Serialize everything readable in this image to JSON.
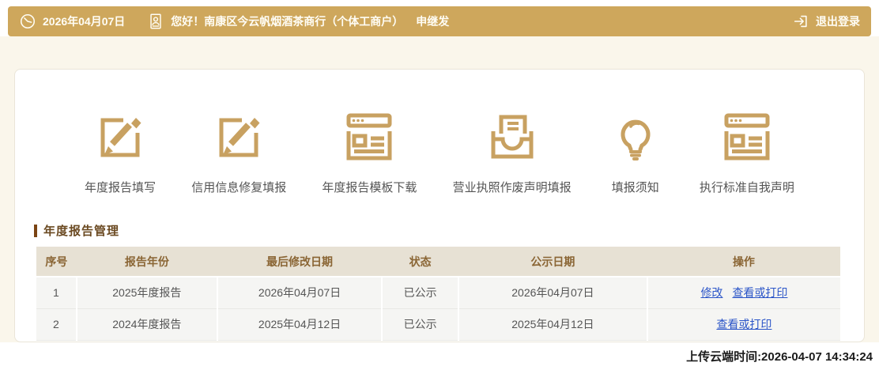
{
  "topbar": {
    "date": "2026年04月07日",
    "greeting": "您好！南康区今云帆烟酒茶商行（个体工商户）",
    "operator": "申继发",
    "logout_label": "退出登录"
  },
  "shortcuts": [
    {
      "icon": "pencil-square-icon",
      "label": "年度报告填写"
    },
    {
      "icon": "pencil-square-icon",
      "label": "信用信息修复填报"
    },
    {
      "icon": "webpage-template-icon",
      "label": "年度报告模板下载"
    },
    {
      "icon": "inbox-document-icon",
      "label": "营业执照作废声明填报"
    },
    {
      "icon": "lightbulb-icon",
      "label": "填报须知"
    },
    {
      "icon": "webpage-declaration-icon",
      "label": "执行标准自我声明"
    }
  ],
  "report_section": {
    "title": "年度报告管理",
    "table": {
      "headers": [
        "序号",
        "报告年份",
        "最后修改日期",
        "状态",
        "公示日期",
        "操作"
      ],
      "rows": [
        {
          "index": "1",
          "year": "2025年度报告",
          "modified": "2026年04月07日",
          "status": "已公示",
          "published": "2026年04月07日",
          "actions": [
            "修改",
            "查看或打印"
          ]
        },
        {
          "index": "2",
          "year": "2024年度报告",
          "modified": "2025年04月12日",
          "status": "已公示",
          "published": "2025年04月12日",
          "actions": [
            "查看或打印"
          ]
        }
      ]
    }
  },
  "footer": {
    "upload_time": "上传云端时间:2026-04-07 14:34:24"
  },
  "colors": {
    "topbar_gold": "#CEA75C",
    "icon_gold": "#C8A161",
    "cream_background": "#FAF6EB",
    "table_header_bg": "#E7E1D4",
    "table_header_text": "#8A6534",
    "row_bg": "#F5F5F3",
    "link_blue": "#2B55C8",
    "section_title_brown": "#6B4A22"
  }
}
